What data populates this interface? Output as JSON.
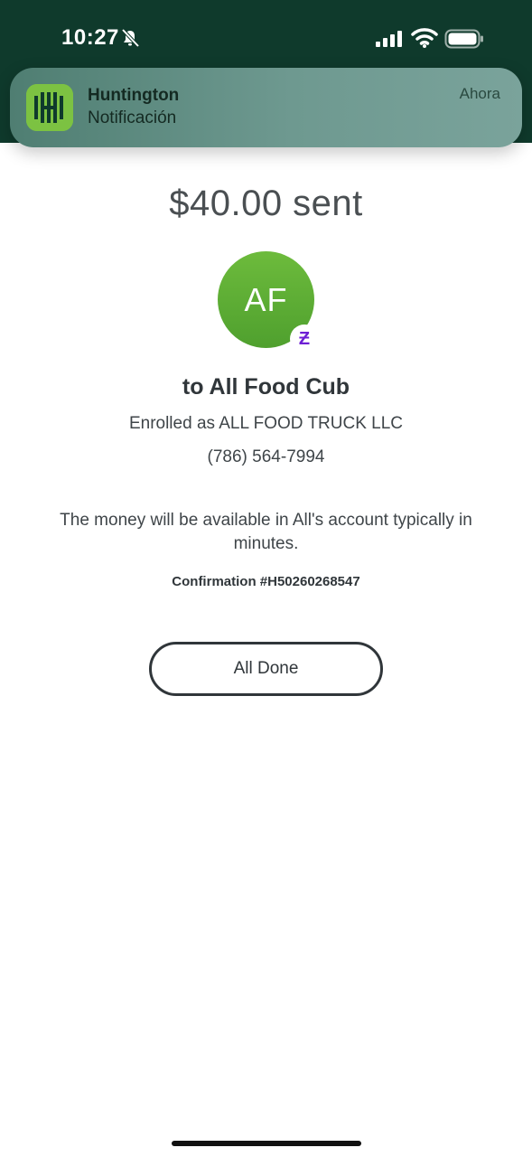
{
  "status_bar": {
    "time": "10:27",
    "icons": [
      "bell-slash-icon",
      "signal-icon",
      "wifi-icon",
      "battery-icon"
    ]
  },
  "notification": {
    "app_name": "Huntington",
    "body": "Notificación",
    "time": "Ahora",
    "icon": "huntington-logo-icon"
  },
  "confirmation_screen": {
    "amount_text": "$40.00 sent",
    "avatar_initials": "AF",
    "avatar_color": "#5aad34",
    "badge_glyph": "Ƶ",
    "badge_icon": "zelle-icon",
    "badge_color": "#6d1ed4",
    "recipient": "to All Food Cub",
    "enrolled_as": "Enrolled as ALL FOOD TRUCK LLC",
    "phone": "(786) 564-7994",
    "availability_message": "The money will be available in All's account typically in minutes.",
    "confirmation": "Confirmation #H50260268547",
    "done_button_label": "All Done"
  },
  "colors": {
    "header_background": "#0f3a2c",
    "text_primary": "#30363a"
  }
}
